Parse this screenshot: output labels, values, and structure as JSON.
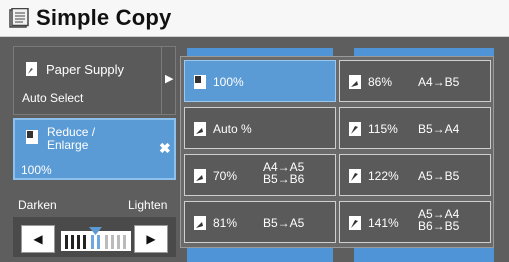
{
  "title": "Simple Copy",
  "left": {
    "paper_supply": {
      "label": "Paper Supply",
      "value": "Auto Select"
    },
    "reduce_enlarge": {
      "label_line1": "Reduce /",
      "label_line2": "Enlarge",
      "value": "100%"
    },
    "density": {
      "darken": "Darken",
      "lighten": "Lighten",
      "left_arrow": "◀",
      "right_arrow": "▶",
      "level": 0.5
    }
  },
  "options": [
    {
      "pct": "100%",
      "size": ""
    },
    {
      "pct": "86%",
      "size": "A4→B5"
    },
    {
      "pct": "Auto %",
      "size": ""
    },
    {
      "pct": "115%",
      "size": "B5→A4"
    },
    {
      "pct": "70%",
      "size_line1": "A4→A5",
      "size_line2": "B5→B6"
    },
    {
      "pct": "122%",
      "size": "A5→B5"
    },
    {
      "pct": "81%",
      "size": "B5→A5"
    },
    {
      "pct": "141%",
      "size_line1": "A5→A4",
      "size_line2": "B6→B5"
    }
  ],
  "colors": {
    "accent": "#5b9bd5",
    "panel": "#5e5e5e",
    "title_bg": "#f7f7f7"
  }
}
